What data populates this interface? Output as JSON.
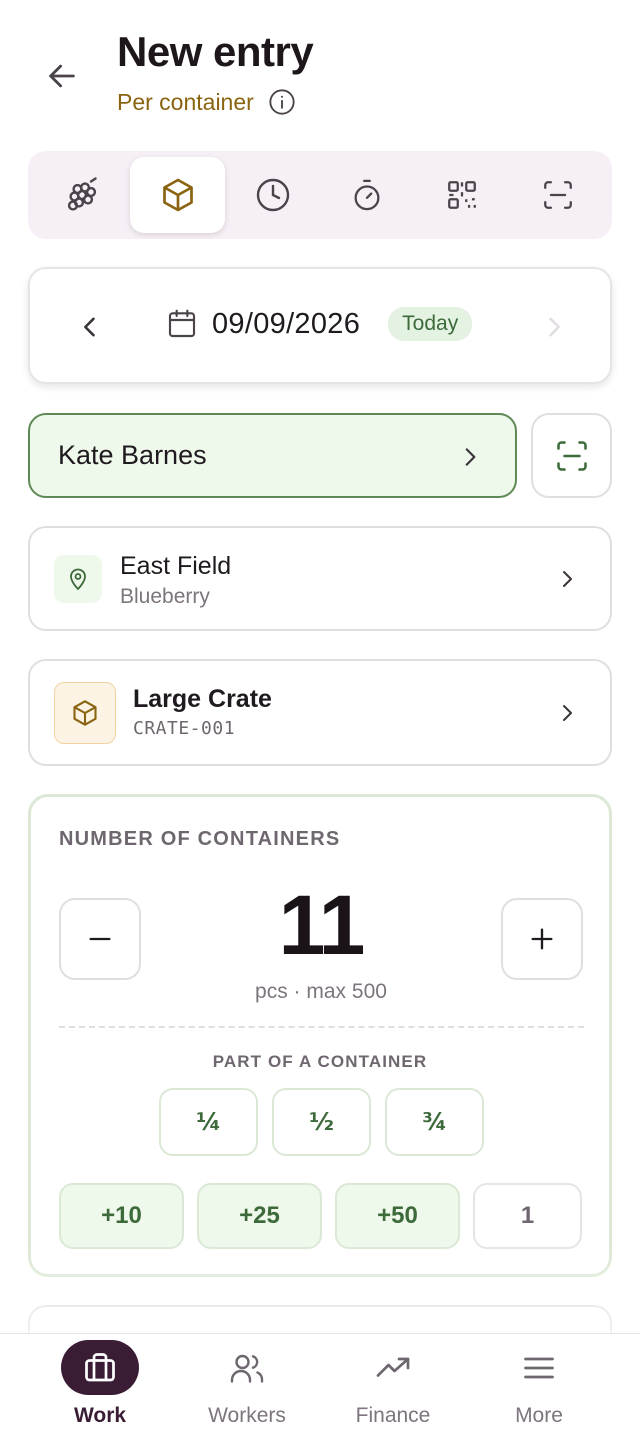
{
  "header": {
    "title": "New entry",
    "subtitle": "Per container",
    "back_icon": "arrow-left-icon",
    "info_icon": "info-icon"
  },
  "mode_bar": {
    "items": [
      {
        "icon": "grapes-icon",
        "active": false
      },
      {
        "icon": "box-icon",
        "active": true
      },
      {
        "icon": "clock-icon",
        "active": false
      },
      {
        "icon": "stopwatch-icon",
        "active": false
      },
      {
        "icon": "qr-code-icon",
        "active": false
      },
      {
        "icon": "scan-icon",
        "active": false
      }
    ]
  },
  "date": {
    "value": "09/09/2026",
    "badge": "Today"
  },
  "worker": {
    "name": "Kate Barnes"
  },
  "field": {
    "name": "East Field",
    "crop": "Blueberry"
  },
  "container": {
    "name": "Large Crate",
    "code": "CRATE-001"
  },
  "quantity": {
    "label": "NUMBER OF CONTAINERS",
    "value": "11",
    "unit": "pcs · max 500",
    "part_label": "PART OF A CONTAINER",
    "fractions": [
      "¼",
      "½",
      "¾"
    ],
    "quick_adds": [
      "+10",
      "+25",
      "+50",
      "1"
    ]
  },
  "tabs": [
    {
      "label": "Work",
      "icon": "briefcase-icon",
      "active": true
    },
    {
      "label": "Workers",
      "icon": "users-icon",
      "active": false
    },
    {
      "label": "Finance",
      "icon": "trending-up-icon",
      "active": false
    },
    {
      "label": "More",
      "icon": "menu-icon",
      "active": false
    }
  ],
  "colors": {
    "accent": "#8a6410",
    "green": "#3d6a3a",
    "green_bg": "#eef8eb",
    "tab_active": "#3a1d35"
  }
}
